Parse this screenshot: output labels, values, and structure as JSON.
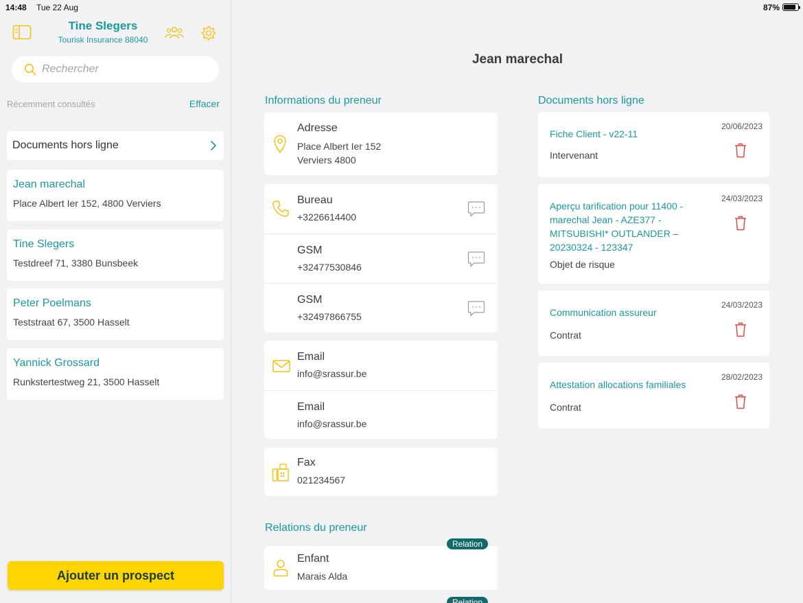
{
  "status": {
    "time": "14:48",
    "date": "Tue 22 Aug",
    "battery": "87%"
  },
  "sidebar": {
    "user_name": "Tine Slegers",
    "user_sub": "Tourisk Insurance 88040",
    "search_placeholder": "Rechercher",
    "recent_label": "Récemment consultés",
    "clear_label": "Effacer",
    "offline_label": "Documents hors ligne",
    "recent": [
      {
        "name": "Jean marechal",
        "address": "Place Albert Ier 152, 4800 Verviers"
      },
      {
        "name": "Tine Slegers",
        "address": "Testdreef 71, 3380 Bunsbeek"
      },
      {
        "name": "Peter Poelmans",
        "address": "Teststraat 67,  3500 Hasselt"
      },
      {
        "name": "Yannick Grossard",
        "address": "Runkstertestweg 21, 3500 Hasselt"
      }
    ],
    "add_button": "Ajouter un prospect"
  },
  "main": {
    "title": "Jean marechal",
    "info_title": "Informations du preneur",
    "address": {
      "label": "Adresse",
      "line1": "Place Albert Ier 152",
      "line2": "Verviers 4800"
    },
    "phones": [
      {
        "label": "Bureau",
        "value": "+3226614400"
      },
      {
        "label": "GSM",
        "value": "+32477530846"
      },
      {
        "label": "GSM",
        "value": "+32497866755"
      }
    ],
    "emails": [
      {
        "label": "Email",
        "value": "info@srassur.be"
      },
      {
        "label": "Email",
        "value": "info@srassur.be"
      }
    ],
    "fax": {
      "label": "Fax",
      "value": "021234567"
    },
    "relations_title": "Relations du preneur",
    "relations": [
      {
        "badge": "Relation",
        "label": "Enfant",
        "value": "Marais Alda"
      },
      {
        "badge": "Relation"
      }
    ],
    "docs_title": "Documents hors ligne",
    "documents": [
      {
        "date": "20/06/2023",
        "title": "Fiche Client - v22-11",
        "type": "Intervenant"
      },
      {
        "date": "24/03/2023",
        "title": "Aperçu tarification pour 11400 - marechal Jean - AZE377 - MITSUBISHI* OUTLANDER – 20230324 - 123347",
        "type": "Objet de risque"
      },
      {
        "date": "24/03/2023",
        "title": "Communication assureur",
        "type": "Contrat"
      },
      {
        "date": "28/02/2023",
        "title": "Attestation allocations familiales",
        "type": "Contrat"
      }
    ]
  },
  "colors": {
    "accent": "#1a9a9a",
    "yellow": "#fcd502",
    "delete": "#e04848",
    "badge": "#126b6b"
  }
}
